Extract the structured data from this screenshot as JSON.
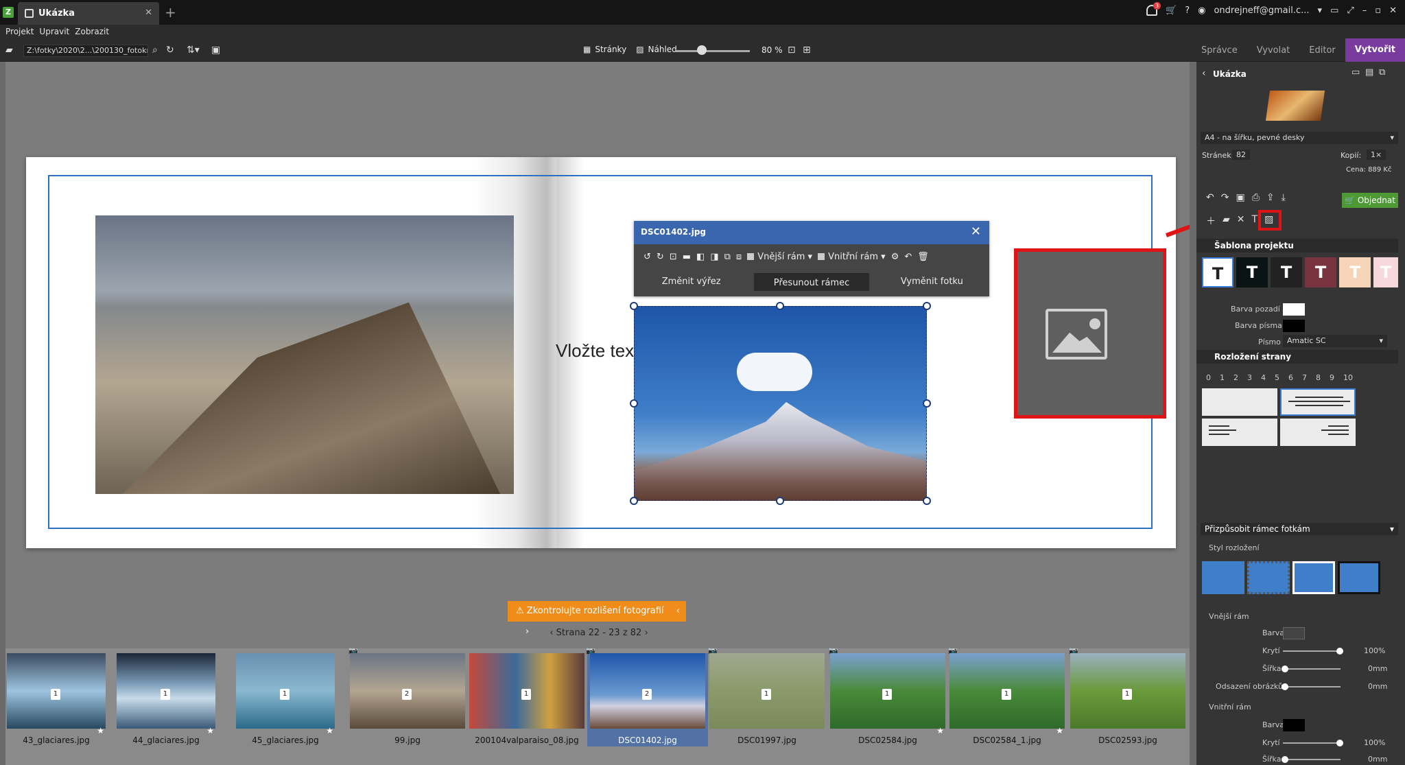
{
  "titlebar": {
    "tab_title": "Ukázka",
    "notification_count": "3",
    "account": "ondrejneff@gmail.c..."
  },
  "menu": {
    "items": [
      "Projekt",
      "Upravit",
      "Zobrazit"
    ]
  },
  "toolbar": {
    "path": "Z:\\fotky\\2020\\2...\\200130_fotokniha",
    "pages_label": "Stránky",
    "preview_label": "Náhled",
    "zoom": "80 %",
    "modes": [
      "Správce",
      "Vyvolat",
      "Editor",
      "Vytvořit"
    ]
  },
  "canvas": {
    "insert_text": "Vložte text",
    "popup": {
      "filename": "DSC01402.jpg",
      "outer_frame": "Vnější rám",
      "inner_frame": "Vnitřní rám",
      "btn_crop": "Změnit výřez",
      "btn_move": "Přesunout rámec",
      "btn_swap": "Vyměnit fotku"
    },
    "warning": "Zkontrolujte rozlišení fotografií",
    "pager": "Strana 22 - 23 z 82"
  },
  "filmstrip": [
    {
      "name": "43_glaciares.jpg",
      "count": "1"
    },
    {
      "name": "44_glaciares.jpg",
      "count": "1"
    },
    {
      "name": "45_glaciares.jpg",
      "count": "1"
    },
    {
      "name": "99.jpg",
      "count": "2"
    },
    {
      "name": "200104valparaiso_08.jpg",
      "count": "1"
    },
    {
      "name": "DSC01402.jpg",
      "count": "2"
    },
    {
      "name": "DSC01997.jpg",
      "count": "1"
    },
    {
      "name": "DSC02584.jpg",
      "count": "1"
    },
    {
      "name": "DSC02584_1.jpg",
      "count": "1"
    },
    {
      "name": "DSC02593.jpg",
      "count": "1"
    }
  ],
  "panel": {
    "title": "Ukázka",
    "format": "A4 - na šířku, pevné desky",
    "pages_label": "Stránek:",
    "pages_value": "82",
    "copies_label": "Kopií:",
    "copies_value": "1×",
    "price": "Cena: 889 Kč",
    "order": "Objednat",
    "template_section": "Šablona projektu",
    "bg_color": "Barva pozadí",
    "font_color": "Barva písma",
    "font_label": "Písmo",
    "font_value": "Amatic SC",
    "layout_section": "Rozložení strany",
    "layout_numbers": [
      "0",
      "1",
      "2",
      "3",
      "4",
      "5",
      "6",
      "7",
      "8",
      "9",
      "10"
    ],
    "fit": "Přizpůsobit rámec fotkám",
    "layout_style": "Styl rozložení",
    "outer_frame": "Vnější rám",
    "color": "Barva",
    "opacity": "Krytí",
    "opacity_val": "100%",
    "width": "Šířka",
    "width_val": "0mm",
    "offset": "Odsazení obrázků",
    "offset_val": "0mm",
    "inner_frame": "Vnitřní rám",
    "color2": "Barva",
    "opacity2": "Krytí",
    "opacity2_val": "100%",
    "width2": "Šířka",
    "width2_val": "0mm"
  },
  "colors": {
    "accent": "#7a3b9e",
    "selection": "#3a66b0",
    "warning": "#f08c1a",
    "callout": "#e01414",
    "order": "#4d9a35"
  }
}
